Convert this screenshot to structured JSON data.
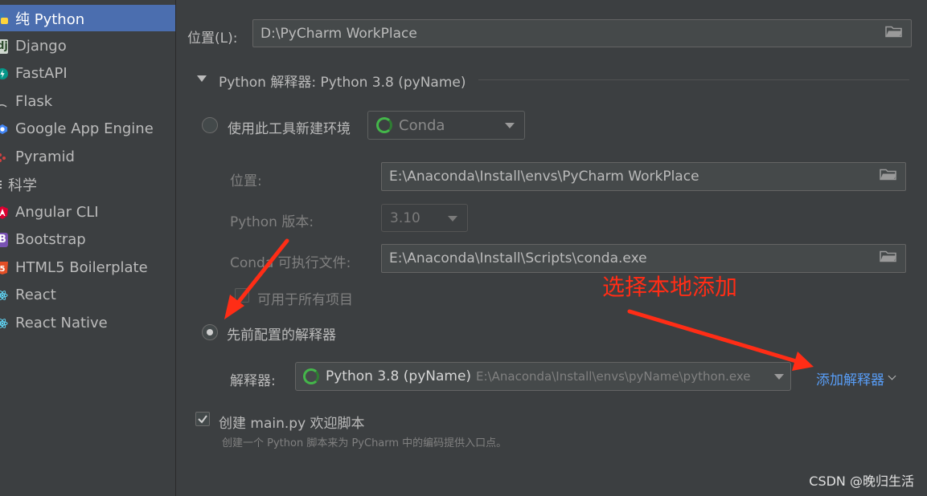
{
  "sidebar": {
    "items": [
      {
        "label": "纯 Python",
        "icon": "python-icon",
        "selected": true
      },
      {
        "label": "Django",
        "icon": "django-icon"
      },
      {
        "label": "FastAPI",
        "icon": "fastapi-icon"
      },
      {
        "label": "Flask",
        "icon": "flask-icon"
      },
      {
        "label": "Google App Engine",
        "icon": "google-app-engine-icon"
      },
      {
        "label": "Pyramid",
        "icon": "pyramid-icon"
      },
      {
        "label": "科学",
        "icon": "scientific-icon"
      },
      {
        "label": "Angular CLI",
        "icon": "angular-icon"
      },
      {
        "label": "Bootstrap",
        "icon": "bootstrap-icon"
      },
      {
        "label": "HTML5 Boilerplate",
        "icon": "html5-icon"
      },
      {
        "label": "React",
        "icon": "react-icon"
      },
      {
        "label": "React Native",
        "icon": "react-native-icon"
      }
    ]
  },
  "location": {
    "label": "位置(L):",
    "value": "D:\\PyCharm WorkPlace"
  },
  "interpreter_section": {
    "title": "Python 解释器: Python 3.8 (pyName)"
  },
  "new_env": {
    "label": "使用此工具新建环境",
    "tool": "Conda",
    "location_label": "位置:",
    "location_value": "E:\\Anaconda\\Install\\envs\\PyCharm WorkPlace",
    "python_version_label": "Python 版本:",
    "python_version_value": "3.10",
    "conda_exe_label": "Conda 可执行文件:",
    "conda_exe_value": "E:\\Anaconda\\Install\\Scripts\\conda.exe",
    "all_projects_label": "可用于所有项目"
  },
  "previous": {
    "label": "先前配置的解释器",
    "interpreter_label": "解释器:",
    "interpreter_name": "Python 3.8 (pyName)",
    "interpreter_path": "E:\\Anaconda\\Install\\envs\\pyName\\python.exe",
    "add_link": "添加解释器"
  },
  "create_main": {
    "label": "创建 main.py 欢迎脚本",
    "hint": "创建一个 Python 脚本来为 PyCharm 中的编码提供入口点。",
    "checked": true
  },
  "annotation": {
    "text": "选择本地添加",
    "color": "#ff2d16"
  },
  "watermark": "CSDN @晚归生活",
  "colors": {
    "selection": "#4b6eaf",
    "link": "#589df6",
    "background": "#3c3f41"
  }
}
